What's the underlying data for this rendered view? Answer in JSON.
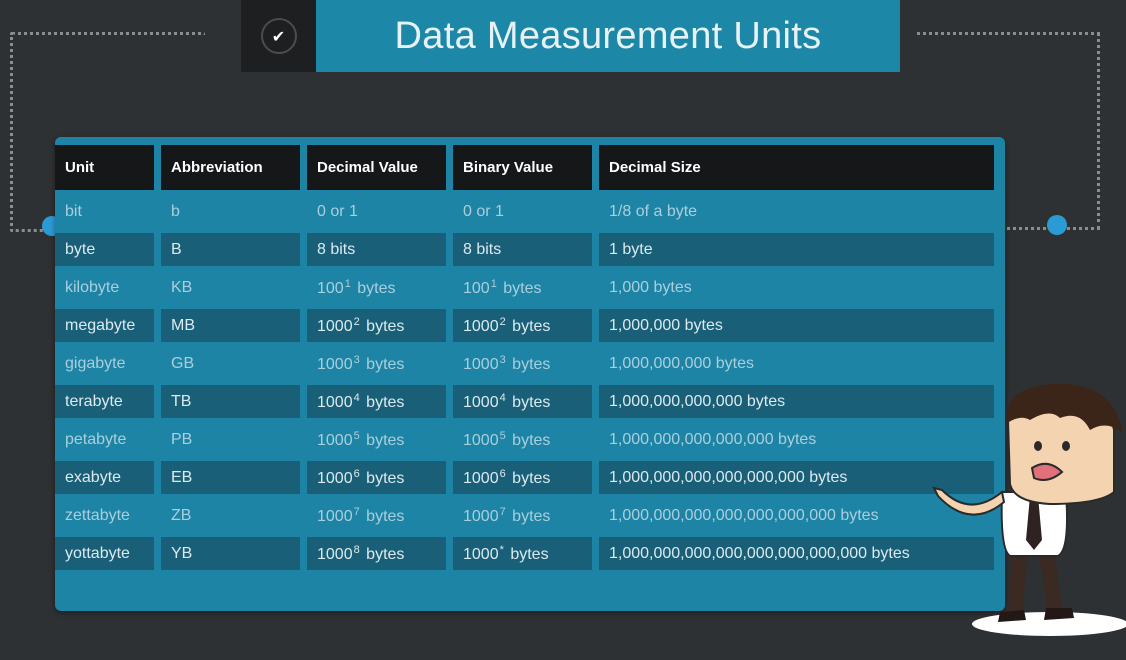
{
  "title": "Data Measurement Units",
  "colors": {
    "background": "#2e3133",
    "accent": "#1d87a7",
    "header": "#151718",
    "row_dark": "#1a5f78",
    "node": "#2b9bd6"
  },
  "table": {
    "headers": [
      "Unit",
      "Abbreviation",
      "Decimal Value",
      "Binary Value",
      "Decimal Size"
    ],
    "rows": [
      {
        "unit": "bit",
        "abbr": "b",
        "dec_base": "0 or 1",
        "dec_exp": "",
        "dec_suffix": "",
        "bin_base": "0 or 1",
        "bin_exp": "",
        "bin_suffix": "",
        "size": "1/8 of a byte"
      },
      {
        "unit": "byte",
        "abbr": "B",
        "dec_base": "8 bits",
        "dec_exp": "",
        "dec_suffix": "",
        "bin_base": "8 bits",
        "bin_exp": "",
        "bin_suffix": "",
        "size": "1 byte"
      },
      {
        "unit": "kilobyte",
        "abbr": "KB",
        "dec_base": "100",
        "dec_exp": "1",
        "dec_suffix": "bytes",
        "bin_base": "100",
        "bin_exp": "1",
        "bin_suffix": "bytes",
        "size": "1,000 bytes"
      },
      {
        "unit": "megabyte",
        "abbr": "MB",
        "dec_base": "1000",
        "dec_exp": "2",
        "dec_suffix": "bytes",
        "bin_base": "1000",
        "bin_exp": "2",
        "bin_suffix": "bytes",
        "size": "1,000,000 bytes"
      },
      {
        "unit": "gigabyte",
        "abbr": "GB",
        "dec_base": "1000",
        "dec_exp": "3",
        "dec_suffix": "bytes",
        "bin_base": "1000",
        "bin_exp": "3",
        "bin_suffix": "bytes",
        "size": "1,000,000,000 bytes"
      },
      {
        "unit": "terabyte",
        "abbr": "TB",
        "dec_base": "1000",
        "dec_exp": "4",
        "dec_suffix": "bytes",
        "bin_base": "1000",
        "bin_exp": "4",
        "bin_suffix": "bytes",
        "size": "1,000,000,000,000 bytes"
      },
      {
        "unit": "petabyte",
        "abbr": "PB",
        "dec_base": "1000",
        "dec_exp": "5",
        "dec_suffix": "bytes",
        "bin_base": "1000",
        "bin_exp": "5",
        "bin_suffix": "bytes",
        "size": "1,000,000,000,000,000 bytes"
      },
      {
        "unit": "exabyte",
        "abbr": "EB",
        "dec_base": "1000",
        "dec_exp": "6",
        "dec_suffix": "bytes",
        "bin_base": "1000",
        "bin_exp": "6",
        "bin_suffix": "bytes",
        "size": "1,000,000,000,000,000,000 bytes"
      },
      {
        "unit": "zettabyte",
        "abbr": "ZB",
        "dec_base": "1000",
        "dec_exp": "7",
        "dec_suffix": "bytes",
        "bin_base": "1000",
        "bin_exp": "7",
        "bin_suffix": "bytes",
        "size": "1,000,000,000,000,000,000,000 bytes"
      },
      {
        "unit": "yottabyte",
        "abbr": "YB",
        "dec_base": "1000",
        "dec_exp": "8",
        "dec_suffix": "bytes",
        "bin_base": "1000",
        "bin_exp": "*",
        "bin_suffix": "bytes",
        "size": "1,000,000,000,000,000,000,000,000 bytes"
      }
    ]
  },
  "icons": {
    "banner": "checkmark-icon",
    "character": "businessman-illustration"
  }
}
